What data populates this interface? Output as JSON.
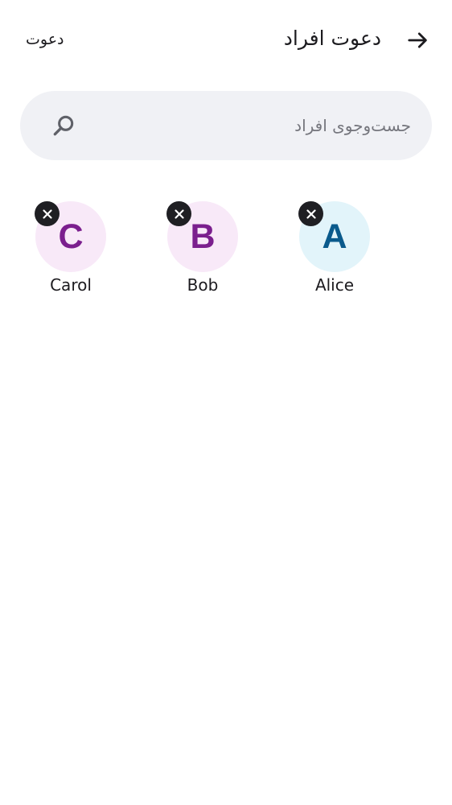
{
  "header": {
    "title": "دعوت افراد",
    "invite_action": "دعوت",
    "back_icon": "arrow-forward-icon"
  },
  "search": {
    "placeholder": "جست‌وجوی افراد",
    "value": "",
    "icon": "search-icon"
  },
  "selected": [
    {
      "initial": "A",
      "name": "Alice",
      "avatar_bg": "#e2f4fa",
      "avatar_fg": "#0a5a8c"
    },
    {
      "initial": "B",
      "name": "Bob",
      "avatar_bg": "#f8e9f8",
      "avatar_fg": "#7b1f8e"
    },
    {
      "initial": "C",
      "name": "Carol",
      "avatar_bg": "#f8e9f8",
      "avatar_fg": "#7b1f8e"
    }
  ],
  "remove_icon": "close-icon"
}
